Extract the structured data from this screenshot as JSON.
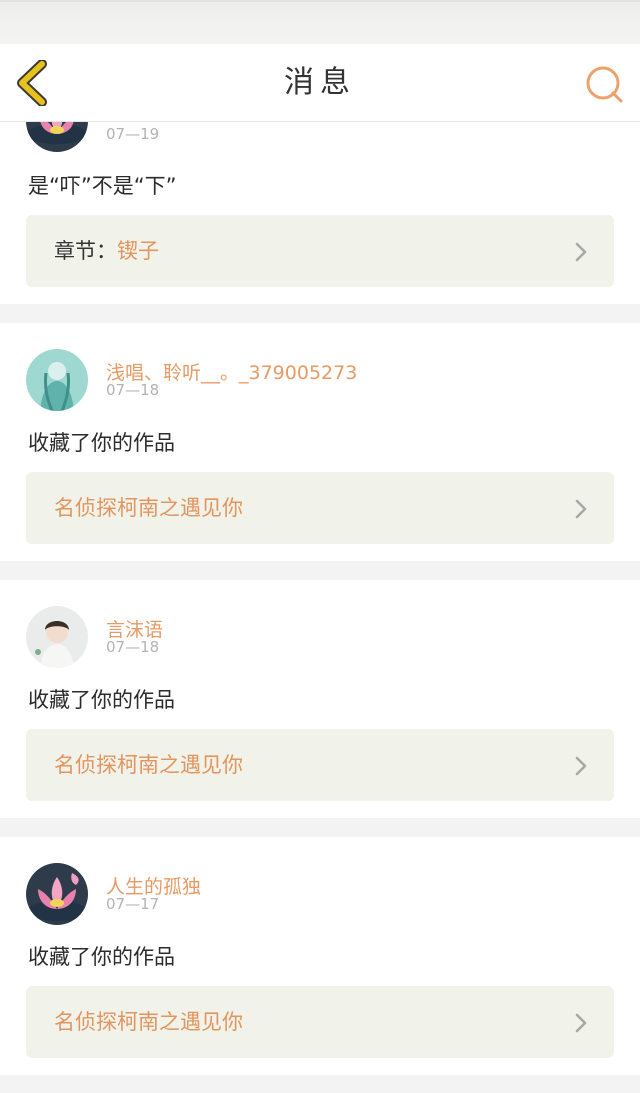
{
  "header": {
    "title": "消息"
  },
  "messages": [
    {
      "user": "",
      "date": "07—19",
      "text": "是“吓”不是“下”",
      "ref_prefix": "章节：",
      "ref_title": "锲子",
      "avatar": "lotus"
    },
    {
      "user": "浅唱、聆听__。_379005273",
      "date": "07—18",
      "text": "收藏了你的作品",
      "ref_prefix": "",
      "ref_title": "名侦探柯南之遇见你",
      "avatar": "teal-figure"
    },
    {
      "user": "言沫语",
      "date": "07—18",
      "text": "收藏了你的作品",
      "ref_prefix": "",
      "ref_title": "名侦探柯南之遇见你",
      "avatar": "person"
    },
    {
      "user": "人生的孤独",
      "date": "07—17",
      "text": "收藏了你的作品",
      "ref_prefix": "",
      "ref_title": "名侦探柯南之遇见你",
      "avatar": "lotus"
    }
  ],
  "colors": {
    "accent": "#e69b66",
    "back_icon": "#e8c21a",
    "ref_bg": "#f1f3ea"
  },
  "icons": {
    "back": "chevron-left-icon",
    "search": "search-icon",
    "ref_arrow": "chevron-right-icon"
  }
}
